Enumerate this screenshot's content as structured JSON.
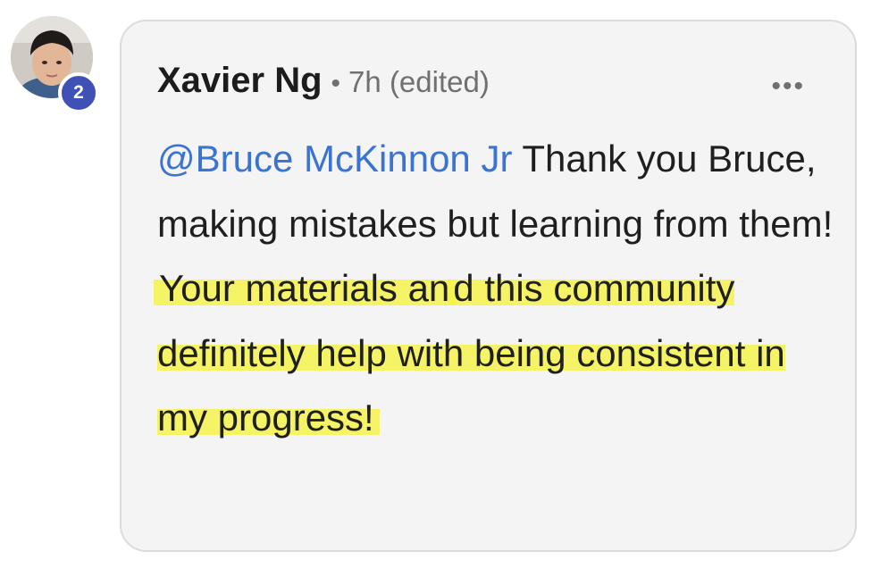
{
  "comment": {
    "avatar_badge": "2",
    "author": "Xavier Ng",
    "separator": "•",
    "time": "7h",
    "edited_label": "(edited)",
    "more_label": "•••",
    "mention": "@Bruce McKinnon Jr",
    "text_before_highlight": " Thank you Bruce, making mistakes but learning from them! ",
    "highlight_lead": "Your materials an",
    "highlight_main": "d this community definitely help with being consistent in my progress!"
  },
  "colors": {
    "mention": "#3b73d1",
    "badge": "#3f51b5",
    "highlight": "#f5f346",
    "card_background": "#f4f4f4"
  },
  "icons": {
    "more": "more-horizontal-icon"
  }
}
